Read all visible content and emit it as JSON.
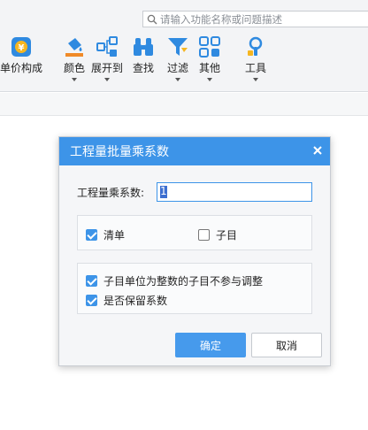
{
  "search": {
    "placeholder": "请输入功能名称或问题描述"
  },
  "ribbon": {
    "tools": [
      {
        "label": "单价构成",
        "icon": "coin-icon"
      },
      {
        "label": "颜色",
        "icon": "paint-bucket-icon",
        "dropdown": true
      },
      {
        "label": "展开到",
        "icon": "tree-expand-icon",
        "dropdown": true
      },
      {
        "label": "查找",
        "icon": "binoculars-icon"
      },
      {
        "label": "过滤",
        "icon": "filter-icon",
        "dropdown": true
      },
      {
        "label": "其他",
        "icon": "grid-icon",
        "dropdown": true
      },
      {
        "label": "工具",
        "icon": "toolbox-icon",
        "dropdown": true
      }
    ]
  },
  "dialog": {
    "title": "工程量批量乘系数",
    "factor_label": "工程量乘系数:",
    "factor_value": "1",
    "scope": {
      "qingdan": {
        "label": "清单",
        "checked": true
      },
      "zimu": {
        "label": "子目",
        "checked": false
      }
    },
    "options": {
      "integer_unit": {
        "label": "子目单位为整数的子目不参与调整",
        "checked": true
      },
      "keep_factor": {
        "label": "是否保留系数",
        "checked": true
      }
    },
    "ok_label": "确定",
    "cancel_label": "取消"
  },
  "colors": {
    "accent": "#3d94e8",
    "title_bar": "#3d94e8",
    "ok_button": "#469aec"
  }
}
